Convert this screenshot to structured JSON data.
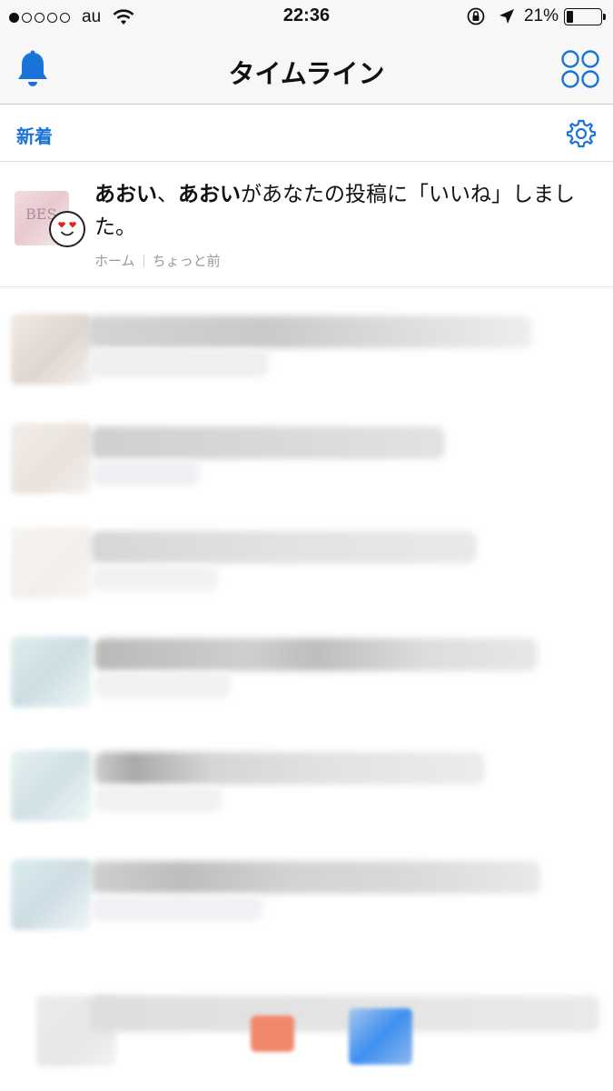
{
  "status_bar": {
    "carrier": "au",
    "time": "22:36",
    "battery_percent": "21%",
    "battery_level": 0.21,
    "signal_dots_filled": 1,
    "signal_dots_total": 5
  },
  "nav": {
    "title": "タイムライン",
    "left_icon": "bell-icon",
    "right_icon": "apps-grid-icon"
  },
  "section": {
    "label": "新着",
    "settings_icon": "gear-icon"
  },
  "notification": {
    "user1": "あおい",
    "separator": "、",
    "user2": "あおい",
    "message": "があなたの投稿に「いいね」しました。",
    "source": "ホーム",
    "time_ago": "ちょっと前",
    "avatar_text": "BES",
    "badge_icon": "heart-eyes-emoji-icon"
  },
  "colors": {
    "accent": "#1a73d9",
    "bar_bg": "#f7f7f7",
    "meta_text": "#9a9a9a"
  }
}
